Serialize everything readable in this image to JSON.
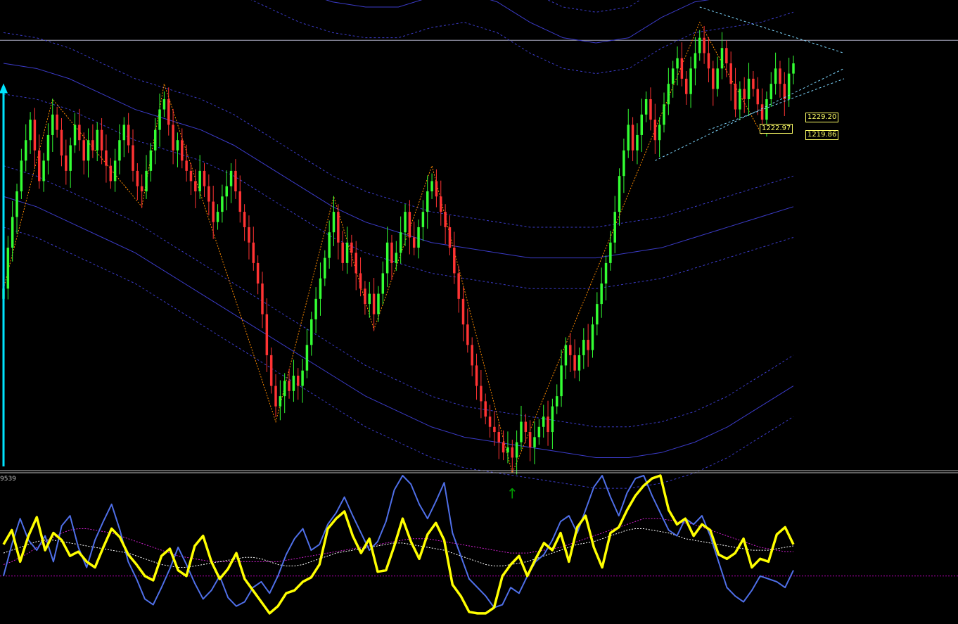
{
  "chart_data": {
    "type": "candlestick",
    "main_panel": {
      "price_labels": [
        "1229.20",
        "1222.97",
        "1219.86"
      ],
      "horizontal_level": 1233.5,
      "ylim": [
        1150,
        1240
      ],
      "colors": {
        "up": "#33ff33",
        "down": "#ff3333",
        "background": "#000000",
        "band": "#3b3bc8",
        "zigzag": "#ff8c00",
        "signal_up": "#00e5ff",
        "arrow_down": "#b000b0",
        "arrow_up": "#009900",
        "trend": "#7fd7ff"
      },
      "closes": [
        1185,
        1193,
        1199,
        1204,
        1210,
        1214,
        1218,
        1212,
        1206,
        1210,
        1215,
        1219,
        1216,
        1211,
        1208,
        1213,
        1217,
        1214,
        1210,
        1214,
        1212,
        1216,
        1212,
        1209,
        1206,
        1210,
        1214,
        1217,
        1213,
        1208,
        1205,
        1204,
        1208,
        1212,
        1216,
        1220,
        1222,
        1217,
        1212,
        1214,
        1210,
        1208,
        1206,
        1204,
        1208,
        1205,
        1202,
        1198,
        1200,
        1203,
        1205,
        1208,
        1204,
        1200,
        1197,
        1194,
        1190,
        1186,
        1180,
        1172,
        1166,
        1162,
        1164,
        1167,
        1165,
        1168,
        1166,
        1169,
        1174,
        1179,
        1183,
        1187,
        1191,
        1196,
        1200,
        1194,
        1190,
        1194,
        1192,
        1188,
        1185,
        1182,
        1184,
        1180,
        1184,
        1188,
        1194,
        1190,
        1192,
        1196,
        1200,
        1195,
        1193,
        1197,
        1200,
        1204,
        1206,
        1203,
        1200,
        1197,
        1193,
        1188,
        1183,
        1178,
        1174,
        1170,
        1166,
        1163,
        1160,
        1158,
        1157,
        1155,
        1153,
        1154,
        1152,
        1155,
        1159,
        1157,
        1154,
        1156,
        1158,
        1160,
        1157,
        1162,
        1164,
        1170,
        1174,
        1172,
        1169,
        1172,
        1175,
        1173,
        1178,
        1182,
        1186,
        1190,
        1194,
        1200,
        1207,
        1212,
        1217,
        1212,
        1215,
        1219,
        1222,
        1218,
        1214,
        1217,
        1221,
        1225,
        1228,
        1230,
        1226,
        1223,
        1228,
        1231,
        1234,
        1231,
        1228,
        1224,
        1228,
        1232,
        1229,
        1225,
        1220,
        1224,
        1222,
        1226,
        1224,
        1221,
        1218,
        1222,
        1225,
        1228,
        1225,
        1222,
        1227,
        1229
      ],
      "bands": [
        {
          "name": "upper-outer",
          "values": [
            1255,
            1256,
            1258,
            1257,
            1255,
            1253,
            1252,
            1249,
            1246,
            1243,
            1241,
            1240,
            1240,
            1242,
            1243,
            1241,
            1237,
            1234,
            1233,
            1234,
            1238,
            1241,
            1242,
            1243,
            1245
          ]
        },
        {
          "name": "middle",
          "values": [
            1229,
            1228,
            1226,
            1223,
            1220,
            1218,
            1216,
            1213,
            1209,
            1205,
            1201,
            1198,
            1196,
            1194,
            1193,
            1192,
            1191,
            1191,
            1191,
            1192,
            1193,
            1195,
            1197,
            1199,
            1201
          ]
        },
        {
          "name": "lower-outer",
          "values": [
            1203,
            1201,
            1198,
            1195,
            1192,
            1188,
            1184,
            1180,
            1176,
            1172,
            1168,
            1164,
            1161,
            1158,
            1156,
            1155,
            1154,
            1153,
            1152,
            1152,
            1153,
            1155,
            1158,
            1162,
            1166
          ]
        }
      ]
    },
    "oscillator": {
      "label": "9539",
      "ylim": [
        0,
        100
      ],
      "yellow": [
        52,
        62,
        40,
        58,
        71,
        48,
        60,
        55,
        44,
        47,
        40,
        36,
        50,
        63,
        57,
        45,
        38,
        30,
        27,
        44,
        49,
        34,
        30,
        51,
        58,
        40,
        28,
        35,
        46,
        28,
        20,
        12,
        4,
        9,
        18,
        20,
        26,
        29,
        38,
        63,
        70,
        75,
        58,
        46,
        56,
        33,
        34,
        51,
        70,
        54,
        42,
        59,
        67,
        55,
        24,
        16,
        5,
        4,
        4,
        8,
        30,
        38,
        44,
        30,
        42,
        53,
        48,
        60,
        40,
        64,
        72,
        50,
        36,
        60,
        64,
        76,
        86,
        93,
        98,
        100,
        76,
        66,
        70,
        58,
        66,
        62,
        45,
        42,
        46,
        56,
        36,
        42,
        40,
        59,
        64,
        52
      ],
      "blue": [
        30,
        52,
        70,
        55,
        48,
        58,
        40,
        65,
        72,
        50,
        36,
        55,
        68,
        80,
        62,
        40,
        28,
        14,
        10,
        22,
        35,
        50,
        38,
        25,
        14,
        20,
        30,
        15,
        9,
        12,
        22,
        26,
        18,
        30,
        45,
        56,
        63,
        48,
        52,
        66,
        74,
        85,
        72,
        60,
        48,
        54,
        68,
        90,
        100,
        94,
        80,
        70,
        82,
        95,
        60,
        44,
        28,
        22,
        16,
        8,
        10,
        22,
        18,
        30,
        40,
        45,
        55,
        68,
        72,
        60,
        76,
        92,
        100,
        85,
        72,
        88,
        98,
        100,
        86,
        74,
        62,
        58,
        70,
        66,
        72,
        58,
        40,
        22,
        16,
        12,
        20,
        30,
        28,
        26,
        22,
        34
      ],
      "signal_white": [
        46,
        48,
        50,
        52,
        54,
        55,
        55,
        54,
        53,
        52,
        51,
        50,
        49,
        48,
        47,
        46,
        44,
        42,
        40,
        38,
        37,
        36,
        36,
        37,
        38,
        39,
        40,
        41,
        42,
        43,
        43,
        42,
        40,
        38,
        37,
        37,
        38,
        40,
        42,
        44,
        46,
        47,
        48,
        49,
        50,
        51,
        52,
        53,
        53,
        52,
        51,
        50,
        49,
        48,
        46,
        44,
        42,
        40,
        38,
        37,
        37,
        38,
        39,
        40,
        42,
        44,
        46,
        48,
        50,
        52,
        53,
        54,
        56,
        58,
        60,
        62,
        63,
        63,
        62,
        61,
        60,
        58,
        56,
        55,
        54,
        53,
        52,
        51,
        50,
        49,
        48,
        48,
        48,
        49,
        50,
        51
      ],
      "signal_magenta": [
        38,
        40,
        43,
        46,
        50,
        54,
        57,
        60,
        62,
        63,
        63,
        62,
        61,
        60,
        58,
        56,
        54,
        52,
        50,
        48,
        46,
        44,
        43,
        42,
        41,
        40,
        40,
        40,
        40,
        40,
        40,
        40,
        40,
        40,
        41,
        42,
        43,
        44,
        45,
        46,
        47,
        48,
        49,
        50,
        51,
        52,
        53,
        54,
        55,
        56,
        56,
        56,
        55,
        54,
        53,
        52,
        51,
        50,
        49,
        48,
        47,
        46,
        46,
        46,
        47,
        48,
        49,
        50,
        52,
        54,
        56,
        58,
        60,
        62,
        64,
        66,
        68,
        70,
        70,
        70,
        69,
        68,
        67,
        66,
        64,
        62,
        60,
        58,
        56,
        54,
        52,
        50,
        49,
        48,
        47,
        47
      ],
      "level": 30
    }
  }
}
